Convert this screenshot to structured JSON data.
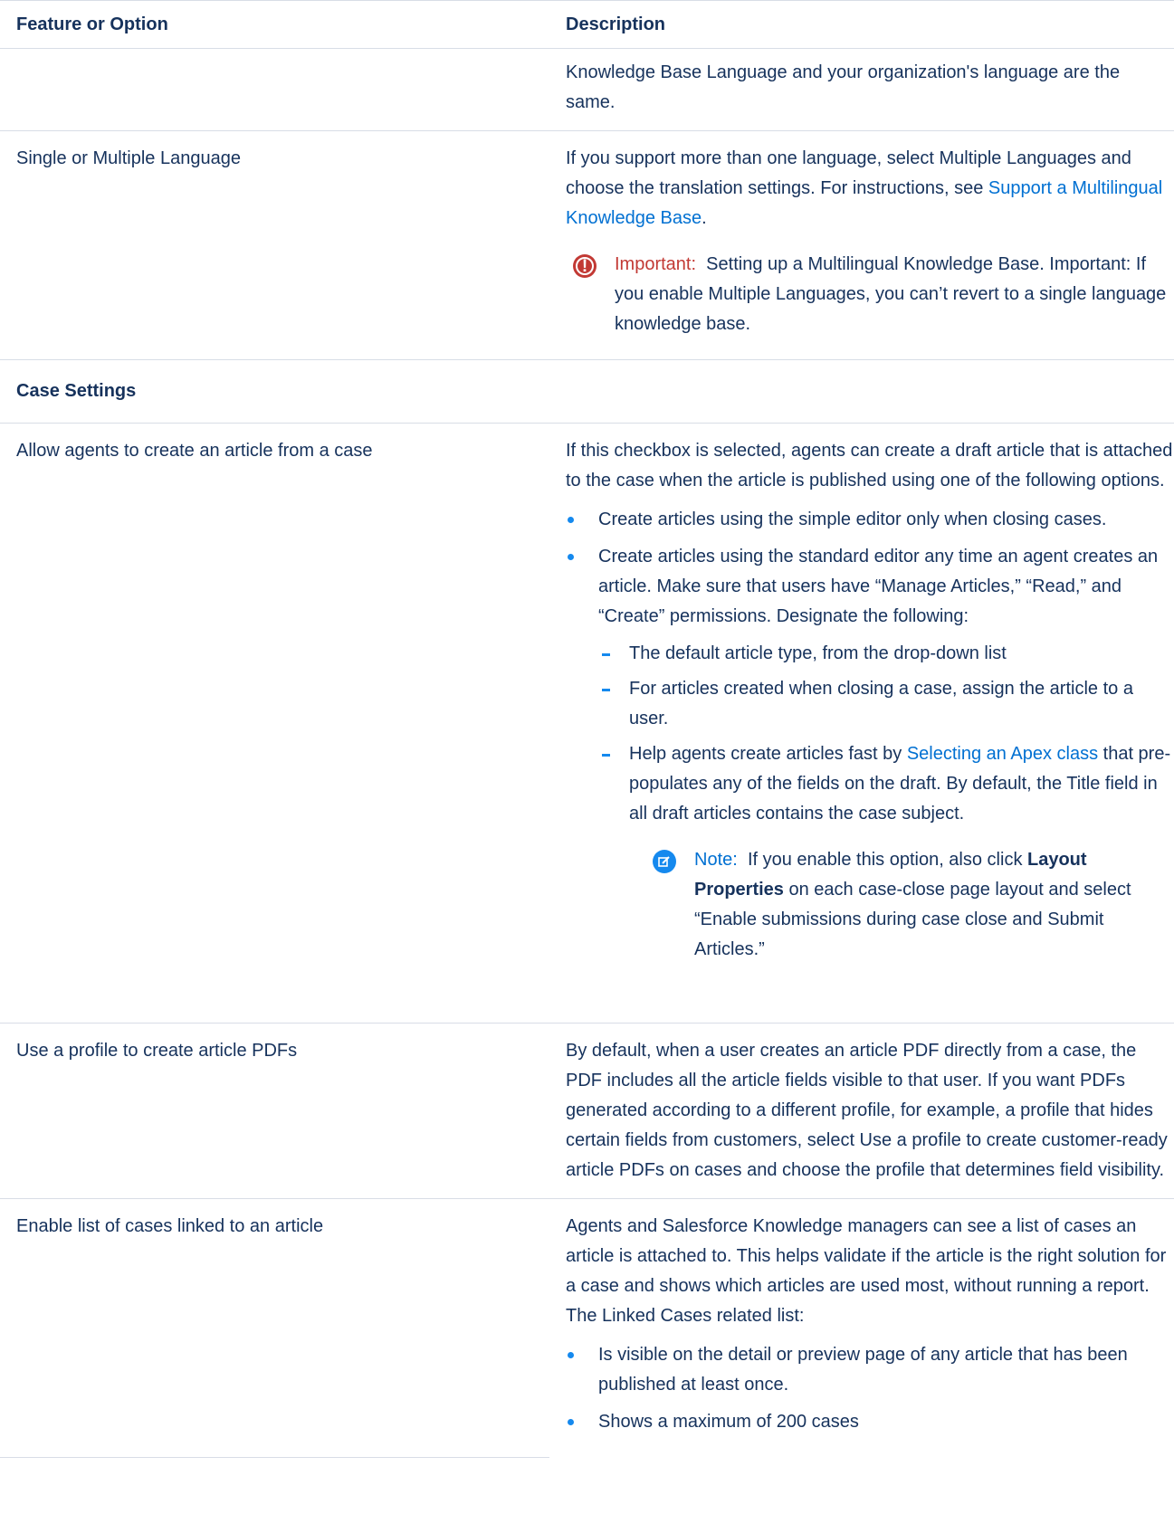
{
  "header": {
    "col1": "Feature or Option",
    "col2": "Description"
  },
  "rows": {
    "r0": {
      "desc": "Knowledge Base Language and your organization's language are the same."
    },
    "r1": {
      "feature": "Single or Multiple Language",
      "desc_a": "If you support more than one language, select Multiple Languages and choose the translation settings. For instructions, see ",
      "desc_link": "Support a Multilingual Knowledge Base",
      "desc_b": ".",
      "callout_label": "Important:",
      "callout_text": "Setting up a Multilingual Knowledge Base. Important: If you enable Multiple Languages, you can’t revert to a single language knowledge base."
    },
    "section": "Case Settings",
    "r2": {
      "feature": "Allow agents to create an article from a case",
      "desc": "If this checkbox is selected, agents can create a draft article that is attached to the case when the article is published using one of the following options.",
      "bullet1": "Create articles using the simple editor only when closing cases.",
      "bullet2": "Create articles using the standard editor any time an agent creates an article. Make sure that users have “Manage Articles,” “Read,” and “Create” permissions. Designate the following:",
      "dash1": "The default article type, from the drop-down list",
      "dash2": "For articles created when closing a case, assign the article to a user.",
      "dash3_a": "Help agents create articles fast by ",
      "dash3_link": "Selecting an Apex class",
      "dash3_b": " that pre-populates any of the fields on the draft. By default, the Title field in all draft articles contains the case subject.",
      "note_label": "Note:",
      "note_a": "If you enable this option, also click ",
      "note_bold": "Layout Properties",
      "note_b": " on each case-close page layout and select “Enable submissions during case close and Submit Articles.”"
    },
    "r3": {
      "feature": "Use a profile to create article PDFs",
      "desc": "By default, when a user creates an article PDF directly from a case, the PDF includes all the article fields visible to that user. If you want PDFs generated according to a different profile, for example, a profile that hides certain fields from customers, select Use a profile to create customer-ready article PDFs on cases and choose the profile that determines field visibility."
    },
    "r4": {
      "feature": "Enable list of cases linked to an article",
      "desc": "Agents and Salesforce Knowledge managers can see a list of cases an article is attached to. This helps validate if the article is the right solution for a case and shows which articles are used most, without running a report. The Linked Cases related list:",
      "bullet1": "Is visible on the detail or preview page of any article that has been published at least once.",
      "bullet2": "Shows a maximum of 200 cases"
    }
  },
  "colors": {
    "text": "#16325c",
    "link": "#0070d2",
    "important": "#c23934",
    "bullet": "#1589ee",
    "border": "#d8dde6"
  },
  "icons": {
    "important": "exclamation-circle-icon",
    "note": "edit-note-icon"
  }
}
